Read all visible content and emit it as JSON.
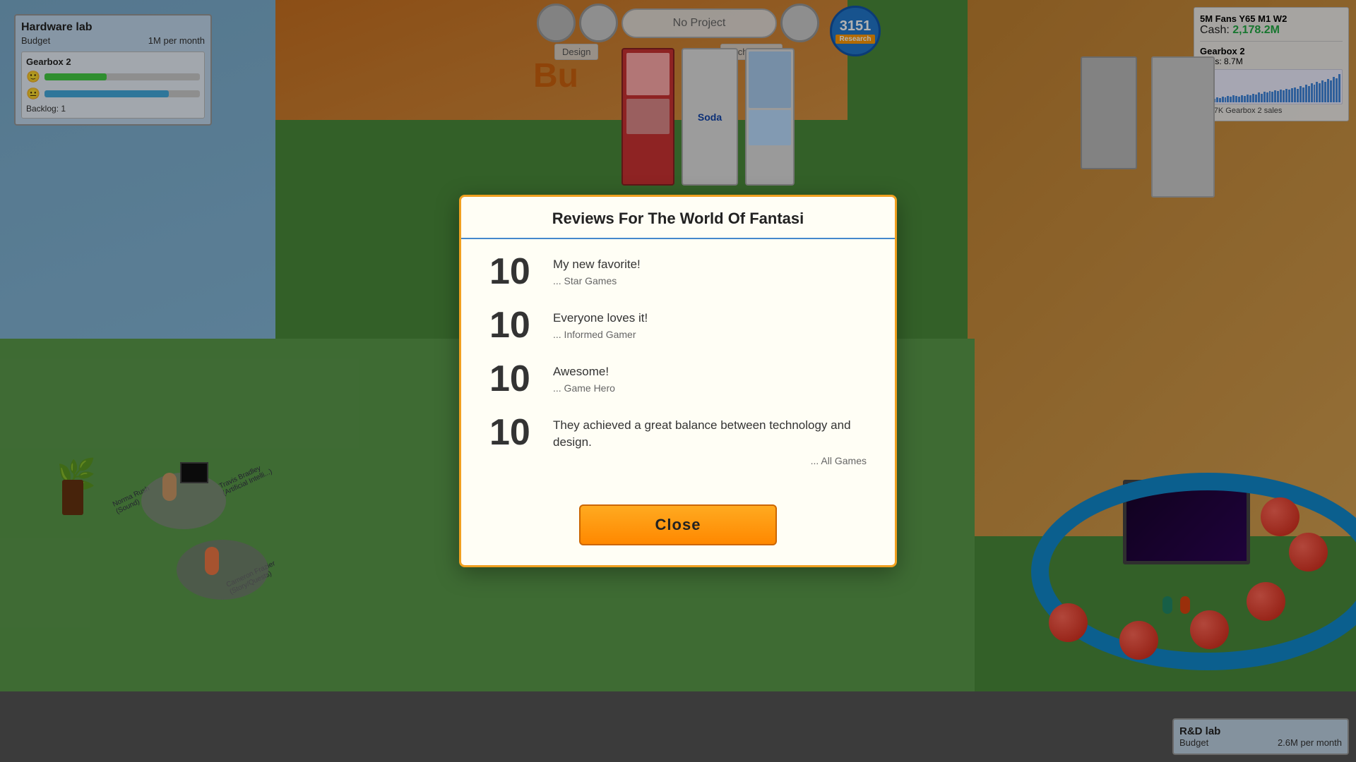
{
  "hardware_lab": {
    "title": "Hardware lab",
    "budget_label": "Budget",
    "budget_value": "1M per month",
    "gearbox_title": "Gearbox 2",
    "backlog_label": "Backlog:",
    "backlog_value": "1",
    "progress_green": 40,
    "progress_blue": 80
  },
  "top_hud": {
    "no_project": "No Project",
    "research_value": "3151",
    "research_label": "Research",
    "design_label": "Design",
    "technology_label": "Technology"
  },
  "right_panel": {
    "fans": "5M Fans Y65 M1 W2",
    "cash_label": "Cash:",
    "cash_value": "2,178.2M",
    "gearbox_title": "Gearbox 2",
    "units_label": "Units:",
    "units_value": "8.7M",
    "sales_label": "111.7K  Gearbox 2 sales"
  },
  "modal": {
    "title": "Reviews For The World Of Fantasi",
    "reviews": [
      {
        "score": "10",
        "comment": "My new favorite!",
        "source": "... Star Games"
      },
      {
        "score": "10",
        "comment": "Everyone loves it!",
        "source": "... Informed Gamer"
      },
      {
        "score": "10",
        "comment": "Awesome!",
        "source": "... Game Hero"
      },
      {
        "score": "10",
        "comment": "They achieved a great balance between technology and design.",
        "source": "... All Games"
      }
    ],
    "close_button": "Close"
  },
  "rd_lab": {
    "title": "R&D lab",
    "budget_label": "Budget",
    "budget_value": "2.6M per month"
  },
  "chart_bars": [
    3,
    5,
    4,
    6,
    5,
    7,
    6,
    8,
    7,
    9,
    8,
    10,
    9,
    8,
    10,
    9,
    11,
    10,
    12,
    11,
    13,
    12,
    14,
    13,
    15,
    14,
    16,
    15,
    17,
    16,
    18,
    17,
    19,
    20,
    18,
    22,
    20,
    24,
    22,
    26,
    24,
    28,
    26,
    30,
    28,
    32,
    30,
    35,
    33,
    38
  ]
}
